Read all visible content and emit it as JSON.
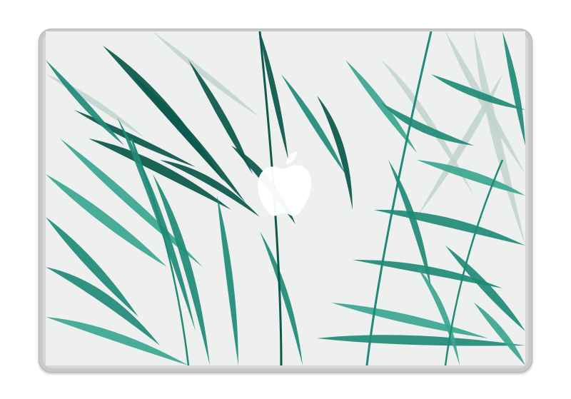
{
  "product": {
    "kind": "laptop-skin-preview",
    "device": "macbook-lid",
    "artwork": "tropical-palm-leaves",
    "colors": {
      "background": "#ffffff",
      "lid_frame": "#c9c9c9",
      "sky": "#eef0ef",
      "leaf_light": "#3aa690",
      "leaf_mid": "#1f8a76",
      "leaf_dark": "#0f5a4e",
      "leaf_pale": "#bfd3cd",
      "apple_logo": "#ffffff"
    },
    "logo_icon": "apple-logo-icon"
  }
}
